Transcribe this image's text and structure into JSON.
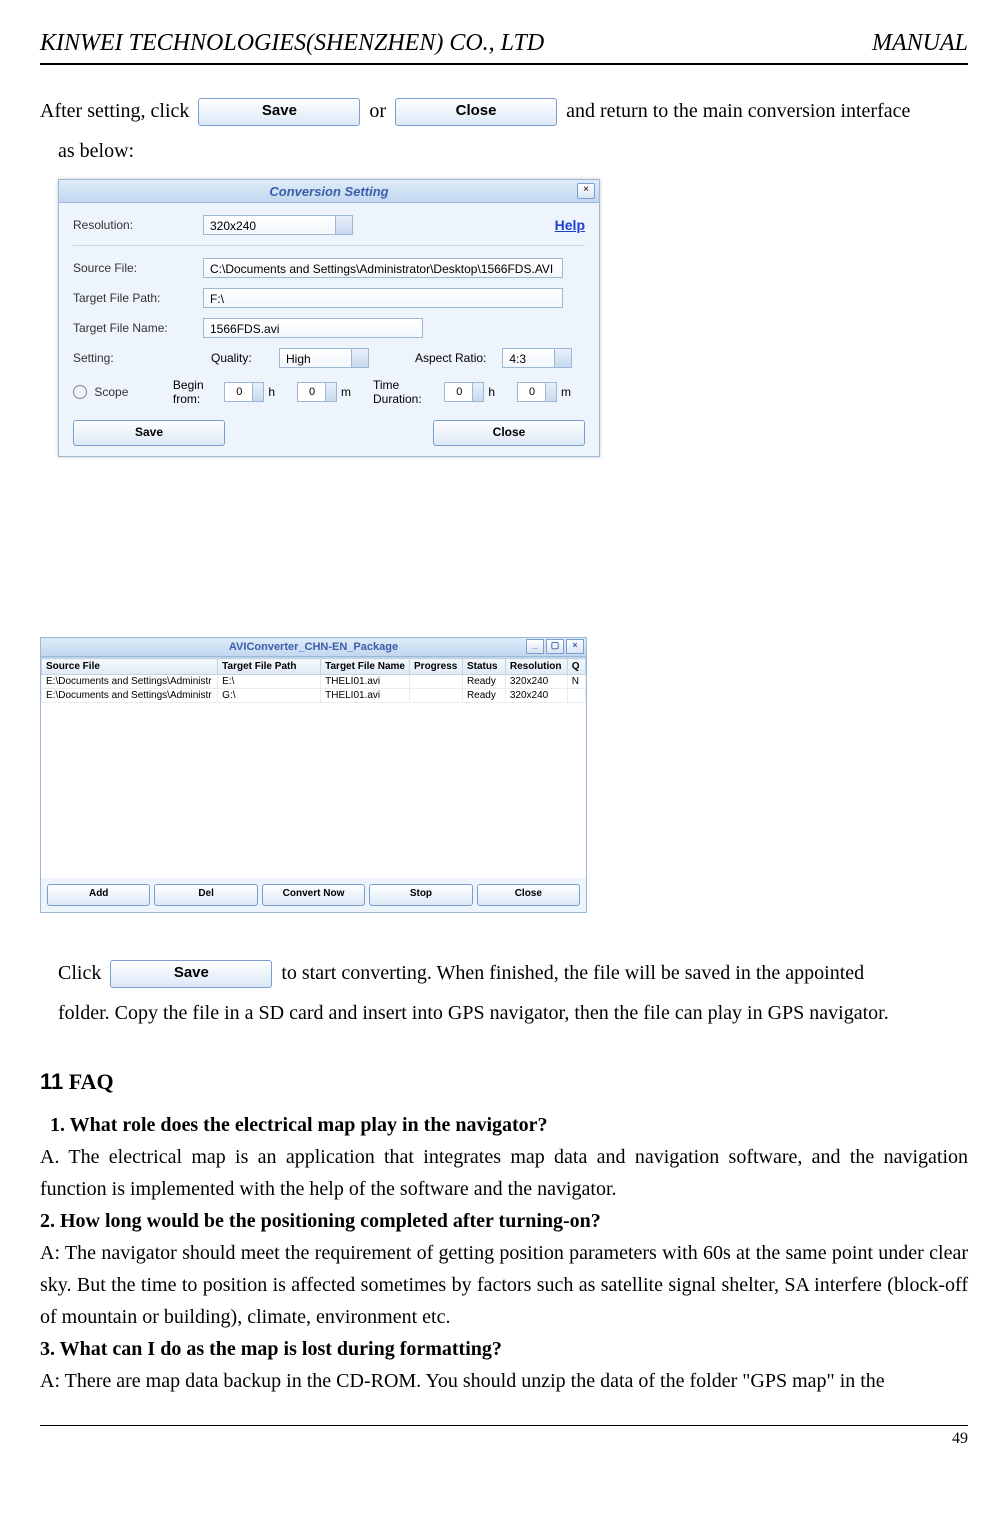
{
  "header": {
    "left": "KINWEI TECHNOLOGIES(SHENZHEN) CO., LTD",
    "right": "MANUAL"
  },
  "intro": {
    "prefix": "After setting, click ",
    "save_btn": "Save",
    "mid": "or",
    "close_btn": "Close",
    "suffix": " and return to the main conversion interface",
    "line2": "as below:"
  },
  "dialog1": {
    "title": "Conversion Setting",
    "close_x": "×",
    "rows": {
      "resolution_label": "Resolution:",
      "resolution_value": "320x240",
      "help": "Help",
      "source_label": "Source File:",
      "source_value": "C:\\Documents and Settings\\Administrator\\Desktop\\1566FDS.AVI",
      "targetpath_label": "Target File Path:",
      "targetpath_value": "F:\\",
      "targetname_label": "Target File Name:",
      "targetname_value": "1566FDS.avi",
      "setting_label": "Setting:",
      "quality_label": "Quality:",
      "quality_value": "High",
      "aspect_label": "Aspect Ratio:",
      "aspect_value": "4:3",
      "scope_label": "Scope",
      "begin_label": "Begin from:",
      "begin_h": "0",
      "begin_m": "0",
      "h_unit": "h",
      "m_unit": "m",
      "duration_label": "Time Duration:",
      "dur_h": "0",
      "dur_m": "0"
    },
    "buttons": {
      "save": "Save",
      "close": "Close"
    }
  },
  "window2": {
    "title": "AVIConverter_CHN-EN_Package",
    "min": "_",
    "max": "▢",
    "close": "×",
    "columns": [
      "Source File",
      "Target File Path",
      "Target File Name",
      "Progress",
      "Status",
      "Resolution",
      "Q"
    ],
    "rows": [
      {
        "source": "E:\\Documents and Settings\\Administr",
        "path": "E:\\",
        "name": "THELI01.avi",
        "progress": "",
        "status": "Ready",
        "res": "320x240",
        "q": "N"
      },
      {
        "source": "E:\\Documents and Settings\\Administr",
        "path": "G:\\",
        "name": "THELI01.avi",
        "progress": "",
        "status": "Ready",
        "res": "320x240",
        "q": ""
      }
    ],
    "buttons": {
      "add": "Add",
      "del": "Del",
      "convert": "Convert Now",
      "stop": "Stop",
      "close": "Close"
    }
  },
  "post": {
    "click": "Click ",
    "save_btn": "Save",
    "after": " to start converting. When finished, the file will be saved in the appointed",
    "line2": "folder. Copy the file in a SD card and insert into GPS navigator, then the file can play in GPS navigator."
  },
  "faq": {
    "heading_num": "11",
    "heading": "FAQ",
    "q1": "1. What role does the electrical map play in the navigator?",
    "a1": "A. The electrical map is an application that integrates map data and navigation software, and the navigation function is implemented with the help of the software and the navigator.",
    "q2": "2. How long would be the positioning completed after turning-on?",
    "a2": "A: The navigator should meet the requirement of getting position parameters with 60s at the same point under clear sky. But the time to position is affected sometimes by factors such as satellite signal shelter, SA interfere (block-off of mountain or building), climate, environment etc.",
    "q3": "3. What can I do as the map is lost during formatting?",
    "a3": "A: There are map data backup in the CD-ROM. You should unzip the data of the folder \"GPS map\" in the"
  },
  "footer": {
    "page": "49"
  }
}
